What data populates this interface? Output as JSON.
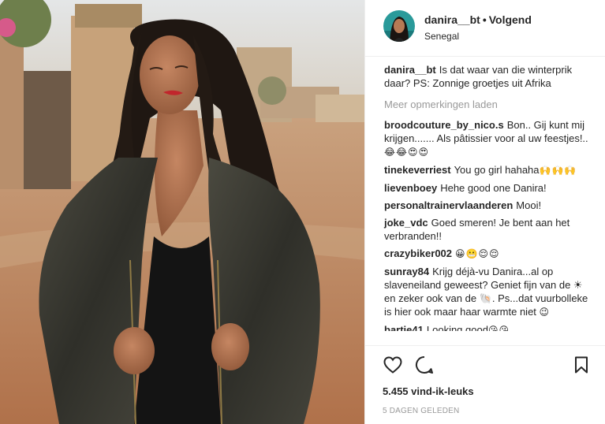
{
  "header": {
    "username": "danira__bt",
    "separator": "•",
    "follow_status": "Volgend",
    "location": "Senegal"
  },
  "caption": {
    "user": "danira__bt",
    "text": "Is dat waar van die winterprik daar? PS: Zonnige groetjes uit Afrika"
  },
  "load_more": "Meer opmerkingen laden",
  "comments": [
    {
      "user": "broodcouture_by_nico.s",
      "text": "Bon.. Gij kunt mij krijgen....... Als pâtissier voor al uw feestjes!..",
      "emoji": "😂😂😍😍"
    },
    {
      "user": "tinekeverriest",
      "text": "You go girl hahaha",
      "emoji": "🙌🙌🙌"
    },
    {
      "user": "lievenboey",
      "text": "Hehe good one Danira!",
      "emoji": ""
    },
    {
      "user": "personaltrainervlaanderen",
      "text": "Mooi!",
      "emoji": ""
    },
    {
      "user": "joke_vdc",
      "text": "Goed smeren! Je bent aan het verbranden!!",
      "emoji": ""
    },
    {
      "user": "crazybiker002",
      "text": "",
      "emoji": "😀😬😌😌"
    },
    {
      "user": "sunray84",
      "text": "Krijg déjà-vu Danira...al op slaveneiland geweest? Geniet fijn van de ☀ en zeker ook van de 🐚. Ps...dat vuurbolleke is hier ook maar haar warmte niet",
      "emoji": "😉"
    },
    {
      "user": "bartje41",
      "text": "Looking good",
      "emoji": "😘😘"
    }
  ],
  "actions": {
    "like_icon": "heart-icon",
    "comment_icon": "comment-bubble-icon",
    "save_icon": "bookmark-icon"
  },
  "likes": "5.455 vind-ik-leuks",
  "timestamp": "5 DAGEN GELEDEN"
}
